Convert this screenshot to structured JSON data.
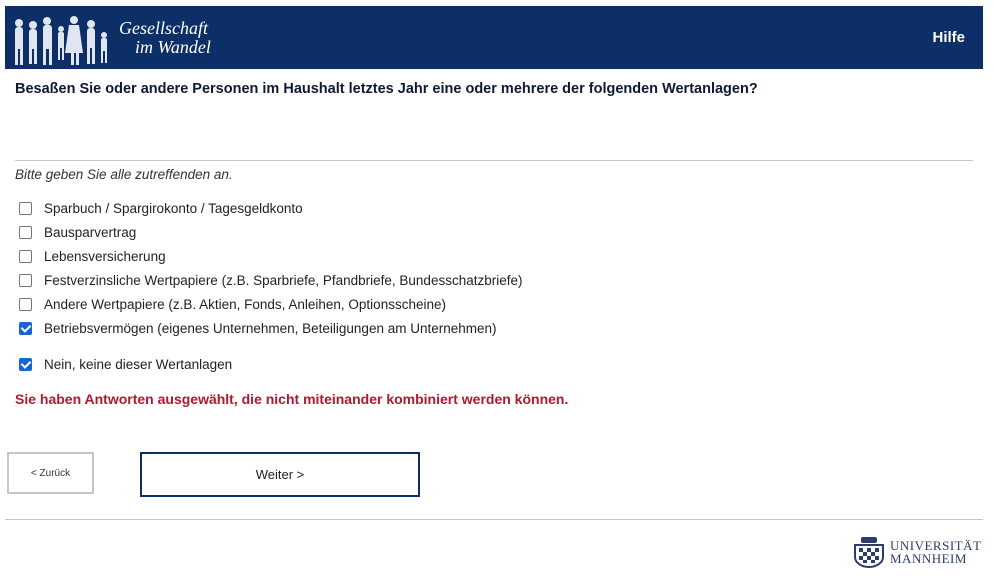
{
  "header": {
    "logo_line1": "Gesellschaft",
    "logo_line2": "im Wandel",
    "help_label": "Hilfe",
    "background": "#0d2f67"
  },
  "question": "Besaßen Sie oder andere Personen im Haushalt letztes Jahr eine oder mehrere der folgenden Wertanlagen?",
  "instruction": "Bitte geben Sie alle zutreffenden an.",
  "options": [
    {
      "label": "Sparbuch / Spargirokonto / Tagesgeldkonto",
      "checked": false
    },
    {
      "label": "Bausparvertrag",
      "checked": false
    },
    {
      "label": "Lebensversicherung",
      "checked": false
    },
    {
      "label": "Festverzinsliche Wertpapiere (z.B. Sparbriefe, Pfandbriefe, Bundesschatzbriefe)",
      "checked": false
    },
    {
      "label": "Andere Wertpapiere (z.B. Aktien, Fonds, Anleihen, Optionsscheine)",
      "checked": false
    },
    {
      "label": "Betriebsvermögen (eigenes Unternehmen, Beteiligungen am Unternehmen)",
      "checked": true
    }
  ],
  "none_option": {
    "label": "Nein, keine dieser Wertanlagen",
    "checked": true
  },
  "error_message": "Sie haben Antworten ausgewählt, die nicht miteinander kombiniert werden können.",
  "error_color": "#b0182e",
  "nav": {
    "back_label": "< Zurück",
    "next_label": "Weiter >"
  },
  "footer": {
    "uni_line1": "UNIVERSITÄT",
    "uni_line2": "MANNHEIM"
  }
}
